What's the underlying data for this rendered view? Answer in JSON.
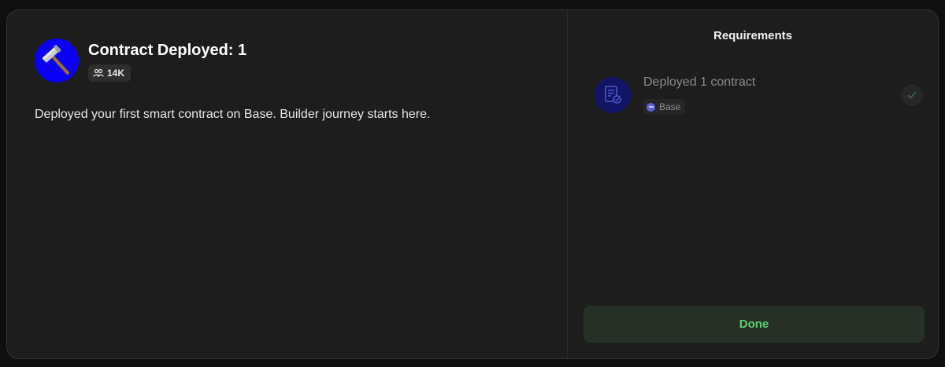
{
  "achievement": {
    "title": "Contract Deployed: 1",
    "holders_count": "14K",
    "description": "Deployed your first smart contract on Base. Builder journey starts here.",
    "icon": "hammer-icon",
    "icon_bg_color": "#0a00f5"
  },
  "requirements": {
    "header": "Requirements",
    "items": [
      {
        "label": "Deployed 1 contract",
        "chain": "Base",
        "icon": "contract-document-icon",
        "completed": true
      }
    ]
  },
  "actions": {
    "done_label": "Done",
    "done_color": "#5fd06f"
  }
}
